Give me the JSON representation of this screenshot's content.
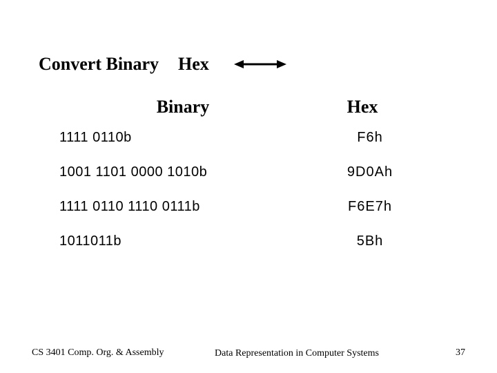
{
  "title": {
    "left": "Convert Binary",
    "right": "Hex"
  },
  "headers": {
    "binary": "Binary",
    "hex": "Hex"
  },
  "rows": [
    {
      "binary": "1111 0110",
      "b": "b",
      "hex": "F6",
      "h": "h"
    },
    {
      "binary": "1001 1101 0000 1010",
      "b": "b",
      "hex": "9D0A",
      "h": "h"
    },
    {
      "binary": "1111 0110 1110 0111",
      "b": "b",
      "hex": "F6E7",
      "h": "h"
    },
    {
      "binary": "1011011",
      "b": "b",
      "hex": "5B",
      "h": "h"
    }
  ],
  "footer": {
    "left": "CS 3401 Comp. Org. & Assembly",
    "center": "Data Representation in Computer Systems",
    "page": "37"
  },
  "chart_data": {
    "type": "table",
    "title": "Convert Binary  Hex",
    "columns": [
      "Binary",
      "Hex"
    ],
    "rows": [
      [
        "1111 0110b",
        "F6h"
      ],
      [
        "1001 1101 0000 1010b",
        "9D0Ah"
      ],
      [
        "1111 0110 1110 0111b",
        "F6E7h"
      ],
      [
        "1011011b",
        "5Bh"
      ]
    ]
  }
}
